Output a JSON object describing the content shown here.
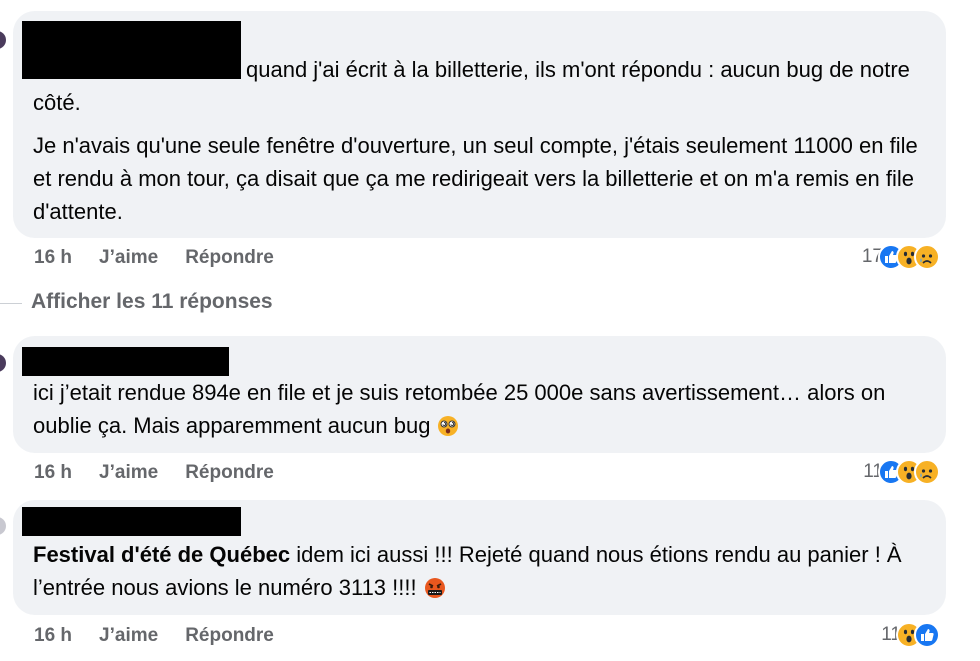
{
  "comments": [
    {
      "text_parts": [
        "quand j'ai écrit à la billetterie, ils m'ont répondu : aucun bug de notre côté.",
        "Je n'avais qu'une seule fenêtre d'ouverture, un seul compte, j'étais seulement 11000 en file et rendu à mon tour, ça disait que ça me redirigeait vers la billetterie et on m'a remis en file d'attente."
      ],
      "time": "16 h",
      "like_label": "J’aime",
      "reply_label": "Répondre",
      "reaction_count": "17",
      "reactions": [
        "like-icon",
        "wow-icon",
        "sad-icon"
      ]
    },
    {
      "text_parts": [
        "ici j’etait rendue 894e en file et je suis retombée 25 000e sans avertissement… alors on oublie ça. Mais apparemment aucun bug"
      ],
      "emoji": "dizzy-face-emoji",
      "time": "16 h",
      "like_label": "J’aime",
      "reply_label": "Répondre",
      "reaction_count": "11",
      "reactions": [
        "like-icon",
        "wow-icon",
        "sad-icon"
      ]
    },
    {
      "mention": "Festival d'été de Québec",
      "text": " idem ici aussi !!! Rejeté quand nous étions rendu au panier ! À l’entrée nous avions le numéro 3113 !!!!",
      "emoji": "cursing-face-emoji",
      "time": "16 h",
      "like_label": "J’aime",
      "reply_label": "Répondre",
      "reaction_count": "11",
      "reactions": [
        "wow-icon",
        "like-icon"
      ]
    }
  ],
  "view_replies": "Afficher les 11 réponses",
  "colors": {
    "bubble": "#f0f2f5",
    "meta_text": "#65676b",
    "like_blue": "#1877f2",
    "emoji_yellow": "#f7b125"
  }
}
